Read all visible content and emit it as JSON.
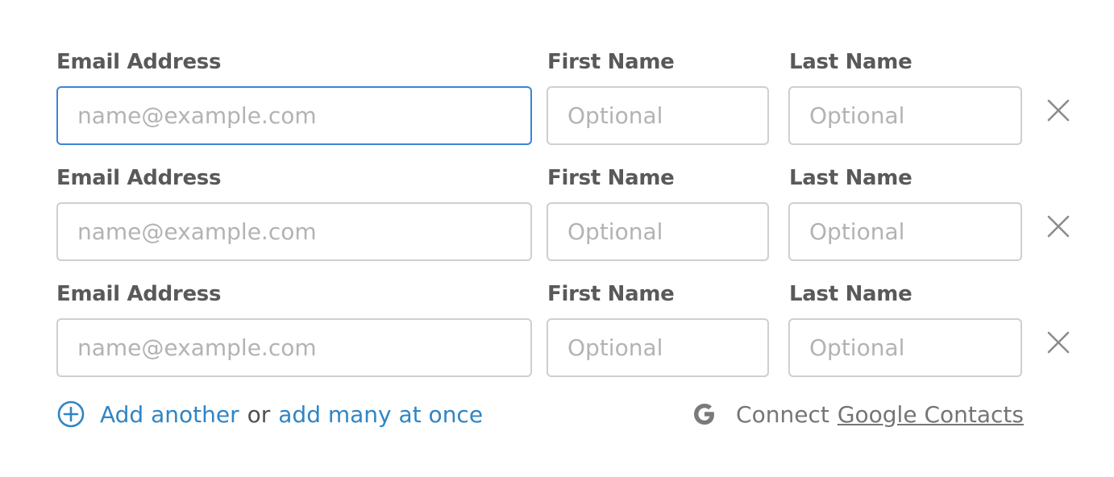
{
  "rows": [
    {
      "email_label": "Email Address",
      "email_placeholder": "name@example.com",
      "first_label": "First Name",
      "first_placeholder": "Optional",
      "last_label": "Last Name",
      "last_placeholder": "Optional",
      "remove_icon": "close-icon",
      "focused": true
    },
    {
      "email_label": "Email Address",
      "email_placeholder": "name@example.com",
      "first_label": "First Name",
      "first_placeholder": "Optional",
      "last_label": "Last Name",
      "last_placeholder": "Optional",
      "remove_icon": "close-icon",
      "focused": false
    },
    {
      "email_label": "Email Address",
      "email_placeholder": "name@example.com",
      "first_label": "First Name",
      "first_placeholder": "Optional",
      "last_label": "Last Name",
      "last_placeholder": "Optional",
      "remove_icon": "close-icon",
      "focused": false
    }
  ],
  "footer": {
    "add_icon": "plus-circle-icon",
    "add_another": "Add another",
    "or_text": "or",
    "add_many": "add many at once",
    "google_icon": "google-g-icon",
    "connect_text": "Connect",
    "google_contacts": "Google Contacts"
  },
  "colors": {
    "link": "#2f85c4",
    "focus_border": "#3b84d6",
    "border": "#cfcfcf",
    "label": "#595959",
    "placeholder": "#b3b3b3",
    "muted": "#757575"
  }
}
